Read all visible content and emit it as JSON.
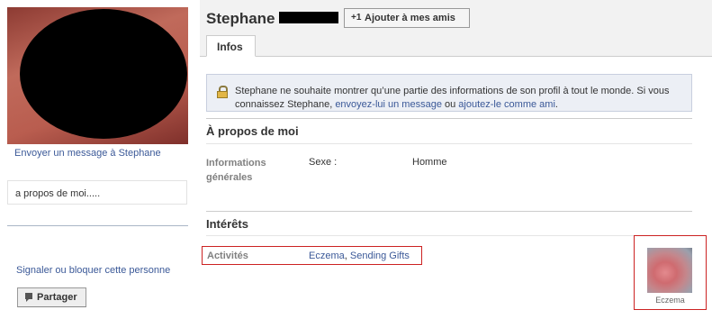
{
  "profile": {
    "name": "Stephane",
    "send_message_link": "Envoyer un message à Stephane",
    "about_me_text": "a propos de moi.....",
    "report_link": "Signaler ou bloquer cette personne",
    "share_button": "Partager",
    "add_friend_button": "Ajouter à mes amis",
    "add_friend_glyph": "+1"
  },
  "tabs": [
    {
      "label": "Infos",
      "active": true
    }
  ],
  "notice": {
    "text_part1": "Stephane ne souhaite montrer qu’une partie des informations de son profil à tout le monde. Si vous connaissez Stephane, ",
    "link_message": "envoyez-lui un message",
    "text_or": " ou ",
    "link_friend": "ajoutez-le comme ami",
    "text_end": "."
  },
  "sections": {
    "about": {
      "title": "À propos de moi",
      "general_info_label": "Informations générales",
      "fields": [
        {
          "label": "Sexe :",
          "value": "Homme"
        }
      ]
    },
    "interests": {
      "title": "Intérêts",
      "activities_label": "Activités",
      "activities": [
        "Eczema",
        "Sending Gifts"
      ],
      "separator": ", ",
      "thumbnail_caption": "Eczema"
    }
  },
  "icons": {
    "lock": "lock-icon",
    "share": "share-icon",
    "add_friend": "add-friend-icon"
  },
  "colors": {
    "link": "#3b5998",
    "header_bg": "#f2f2f2",
    "notice_bg": "#eceff5",
    "highlight_border": "#cc2222"
  }
}
